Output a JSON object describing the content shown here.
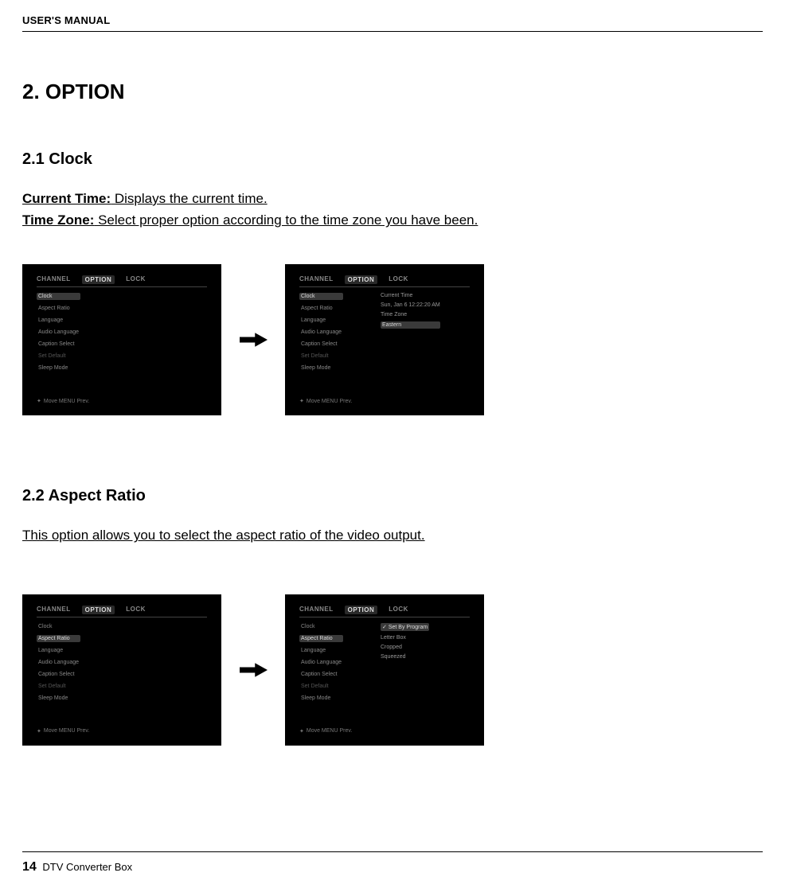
{
  "header": {
    "title": "USER'S MANUAL"
  },
  "sections": {
    "h1": "2. OPTION",
    "clock": {
      "heading": "2.1 Clock",
      "line1_label": "Current Time:",
      "line1_text": " Displays the current time.",
      "line2_label": "Time Zone:",
      "line2_text": " Select proper option according to the time zone you have been."
    },
    "aspect": {
      "heading": "2.2 Aspect Ratio",
      "line1": "This option allows you to select the aspect ratio of the video output."
    }
  },
  "screenshots": {
    "tabs": [
      "CHANNEL",
      "OPTION",
      "LOCK"
    ],
    "menu": {
      "clock": "Clock",
      "aspect_ratio": "Aspect Ratio",
      "language": "Language",
      "audio_language": "Audio Language",
      "caption_select": "Caption Select",
      "set_default": "Set Default",
      "sleep_mode": "Sleep Mode"
    },
    "clock_panel": {
      "current_time": "Current Time",
      "date_time": "Sun, Jan 6    12:22:20 AM",
      "time_zone_label": "Time Zone",
      "time_zone_value": "Eastern"
    },
    "aspect_panel": {
      "set_by_program": "Set By Program",
      "letter_box": "Letter Box",
      "cropped": "Cropped",
      "squeezed": "Squeezed"
    },
    "hint": "Move  MENU Prev."
  },
  "footer": {
    "page": "14",
    "product": "DTV Converter Box"
  }
}
